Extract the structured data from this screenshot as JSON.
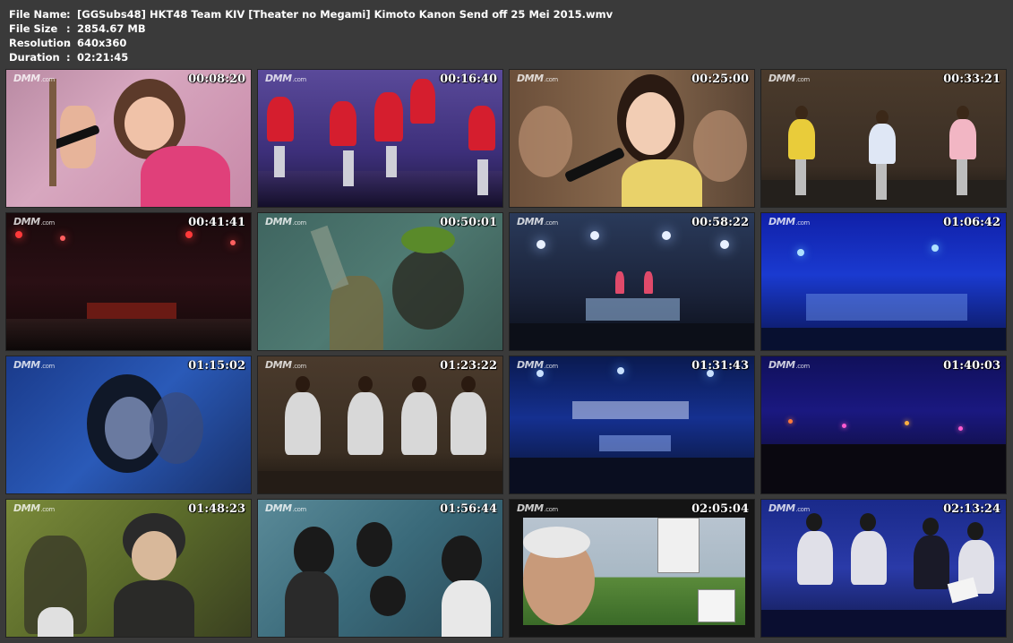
{
  "info": {
    "file_name_label": "File Name",
    "file_name": "[GGSubs48] HKT48 Team KIV [Theater no Megami] Kimoto Kanon Send off 25 Mei 2015.wmv",
    "file_size_label": "File Size",
    "file_size": "2854.67 MB",
    "resolution_label": "Resolution",
    "resolution": "640x360",
    "duration_label": "Duration",
    "duration": "02:21:45",
    "separator": ":"
  },
  "watermark": "DMM",
  "watermark_suffix": ".com",
  "thumbnails": [
    {
      "time": "00:08:20"
    },
    {
      "time": "00:16:40"
    },
    {
      "time": "00:25:00"
    },
    {
      "time": "00:33:21"
    },
    {
      "time": "00:41:41"
    },
    {
      "time": "00:50:01"
    },
    {
      "time": "00:58:22"
    },
    {
      "time": "01:06:42"
    },
    {
      "time": "01:15:02"
    },
    {
      "time": "01:23:22"
    },
    {
      "time": "01:31:43"
    },
    {
      "time": "01:40:03"
    },
    {
      "time": "01:48:23"
    },
    {
      "time": "01:56:44"
    },
    {
      "time": "02:05:04"
    },
    {
      "time": "02:13:24"
    }
  ]
}
